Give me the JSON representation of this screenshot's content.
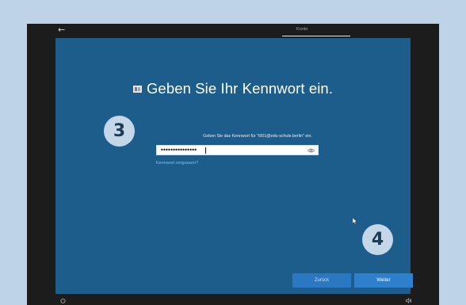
{
  "window": {
    "tab_label": "Konto",
    "back_icon": "arrow-left-icon"
  },
  "signin": {
    "title": "Geben Sie Ihr Kennwort ein.",
    "prompt": "Geben Sie das Kennwort für \"t001@edu-schule.berlin\" ein.",
    "password_value": "•••••••••••••••",
    "forgot_link": "Kennwort vergessen?",
    "back_button": "Zurück",
    "next_button": "Weiter"
  },
  "annotations": {
    "step_a": "3",
    "step_b": "4"
  },
  "colors": {
    "oobe_background": "#1d5d8c",
    "button": "#2e7fcc",
    "link": "#7fc0ef",
    "badge": "#c3d7e9",
    "page_background": "#bed4e6"
  },
  "icons": [
    "arrow-left-icon",
    "account-icon",
    "eye-icon",
    "mouse-pointer-icon",
    "power-icon",
    "volume-icon"
  ]
}
